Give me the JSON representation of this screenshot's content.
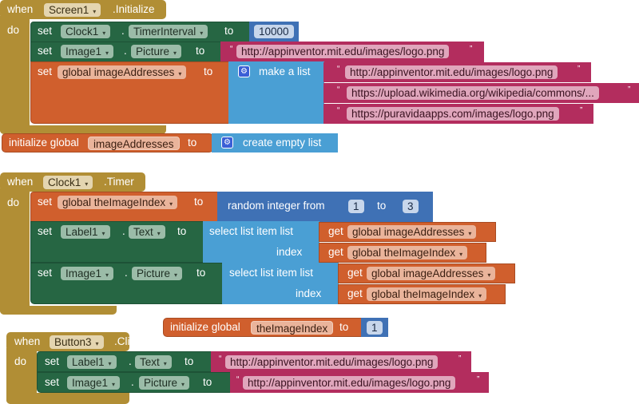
{
  "blocks": {
    "screen_init": {
      "when": "when",
      "component": "Screen1",
      "event": ".Initialize",
      "do": "do",
      "set1": {
        "set": "set",
        "component": "Clock1",
        "dot": ".",
        "property": "TimerInterval",
        "to": "to",
        "value": "10000"
      },
      "set2": {
        "set": "set",
        "component": "Image1",
        "dot": ".",
        "property": "Picture",
        "to": "to",
        "value": "http://appinventor.mit.edu/images/logo.png"
      },
      "set3": {
        "set": "set",
        "variable": "global imageAddresses",
        "to": "to",
        "make_list": "make a list",
        "items": [
          "http://appinventor.mit.edu/images/logo.png",
          "https://upload.wikimedia.org/wikipedia/commons/...",
          "https://puravidaapps.com/images/logo.png"
        ]
      }
    },
    "init_addresses": {
      "label": "initialize global",
      "name": "imageAddresses",
      "to": "to",
      "value": "create empty list"
    },
    "clock_timer": {
      "when": "when",
      "component": "Clock1",
      "event": ".Timer",
      "do": "do",
      "set1": {
        "set": "set",
        "variable": "global theImageIndex",
        "to": "to",
        "random": "random integer from",
        "from": "1",
        "to2": "to",
        "upto": "3"
      },
      "set2": {
        "set": "set",
        "component": "Label1",
        "dot": ".",
        "property": "Text",
        "to": "to",
        "select": "select list item  list",
        "index": "index",
        "get": "get",
        "list_var": "global imageAddresses",
        "index_var": "global theImageIndex"
      },
      "set3": {
        "set": "set",
        "component": "Image1",
        "dot": ".",
        "property": "Picture",
        "to": "to",
        "select": "select list item  list",
        "index": "index",
        "get": "get",
        "list_var": "global imageAddresses",
        "index_var": "global theImageIndex"
      }
    },
    "init_index": {
      "label": "initialize global",
      "name": "theImageIndex",
      "to": "to",
      "value": "1"
    },
    "button_click": {
      "when": "when",
      "component": "Button3",
      "event": ".Click",
      "do": "do",
      "set1": {
        "set": "set",
        "component": "Label1",
        "dot": ".",
        "property": "Text",
        "to": "to",
        "value": "http://appinventor.mit.edu/images/logo.png"
      },
      "set2": {
        "set": "set",
        "component": "Image1",
        "dot": ".",
        "property": "Picture",
        "to": "to",
        "value": "http://appinventor.mit.edu/images/logo.png"
      }
    }
  },
  "glyphs": {
    "dropdown": "▾",
    "open_quote": "“",
    "close_quote": "”",
    "gear": "⚙"
  }
}
